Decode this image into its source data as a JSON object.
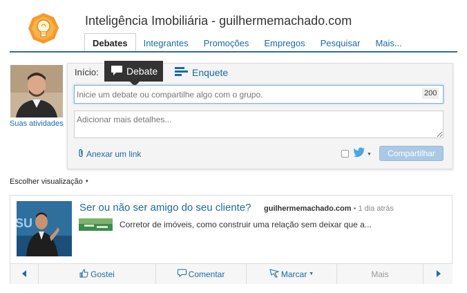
{
  "header": {
    "group_title": "Inteligência Imobiliária - guilhermemachado.com"
  },
  "tabs": [
    {
      "label": "Debates",
      "active": true
    },
    {
      "label": "Integrantes"
    },
    {
      "label": "Promoções"
    },
    {
      "label": "Empregos"
    },
    {
      "label": "Pesquisar"
    },
    {
      "label": "Mais..."
    }
  ],
  "user": {
    "activity_link": "Suas atividades"
  },
  "composer": {
    "start_label": "Início:",
    "debate_tab": "Debate",
    "poll_tab": "Enquete",
    "topic_placeholder": "Inicie um debate ou compartilhe algo com o grupo.",
    "char_count": "200",
    "details_placeholder": "Adicionar mais detalhes...",
    "attach_link": "Anexar um link",
    "share_button": "Compartilhar",
    "twitter_checked": false
  },
  "view_select": "Escolher visualização",
  "post": {
    "title": "Ser ou não ser amigo do seu cliente?",
    "author": "guilhermemachado.com",
    "time": " • 1 dia atrás",
    "snippet": "Corretor de imóveis, como construir uma relação sem deixar que a..."
  },
  "actions": {
    "like": "Gostei",
    "comment": "Comentar",
    "flag": "Marcar",
    "more": "Mais"
  },
  "colors": {
    "link": "#1a6aa3",
    "accent_line": "#2d6a9f",
    "share_button": "#a9c9e4",
    "twitter": "#4aa5e0",
    "logo": "#f39a2b"
  }
}
